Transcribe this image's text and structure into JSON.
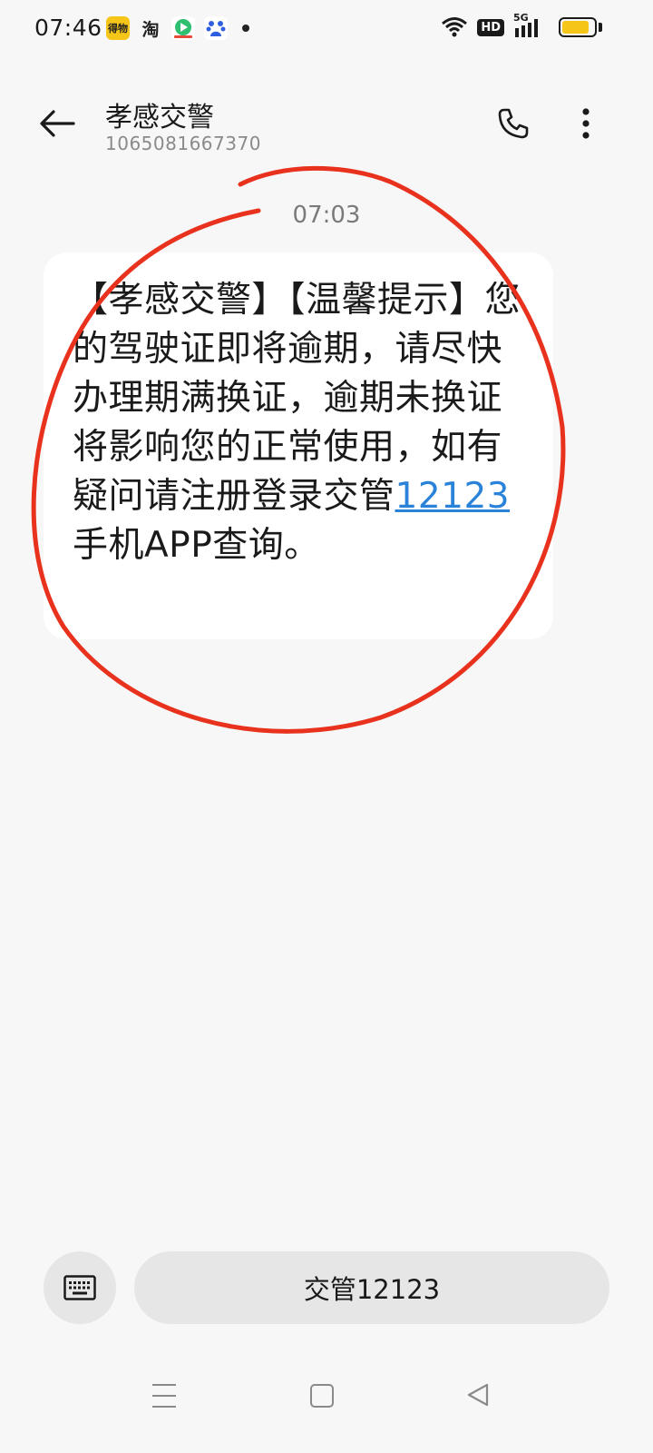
{
  "status_bar": {
    "time": "07:46",
    "apps": [
      "dewu-icon",
      "taobao-icon",
      "video-icon",
      "baidu-icon"
    ],
    "dewu_label": "得物",
    "taobao_label": "淘",
    "hd": "HD",
    "network": "5G",
    "battery_level": 0.85
  },
  "header": {
    "contact_name": "孝感交警",
    "contact_number": "1065081667370"
  },
  "conversation": {
    "timestamp": "07:03",
    "message_before_link": "【孝感交警】【温馨提示】您的驾驶证即将逾期，请尽快办理期满换证，逾期未换证将影响您的正常使用，如有疑问请注册登录交管",
    "message_link": "12123",
    "message_after_link": "手机APP查询。"
  },
  "compose": {
    "quick_reply": "交管12123"
  },
  "colors": {
    "link": "#2a83d8",
    "annotation": "#e8321e",
    "battery": "#f5c518"
  }
}
